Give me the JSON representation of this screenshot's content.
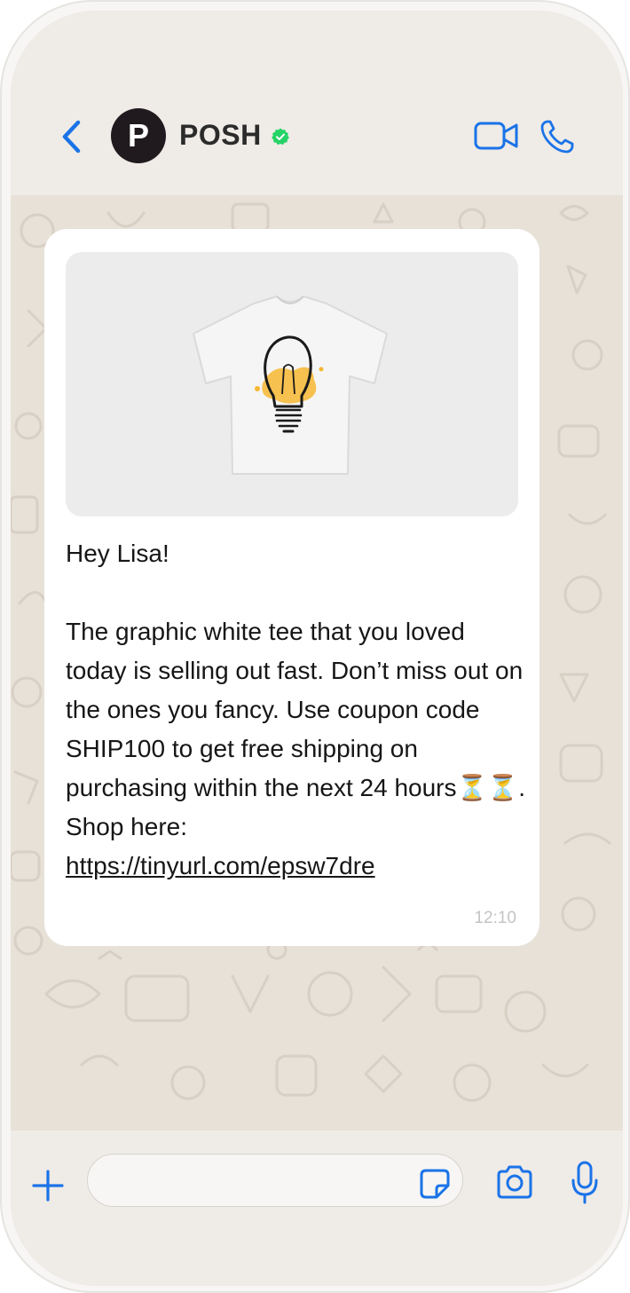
{
  "header": {
    "avatar_letter": "P",
    "contact_name": "POSH"
  },
  "message": {
    "image": "graphic-white-tee-lightbulb",
    "text": "Hey Lisa!\n\nThe graphic white tee that you loved today is selling out fast. Don’t miss out on the ones you fancy. Use coupon code SHIP100 to get free shipping on purchasing within the next 24 hours⏳⏳. Shop here:\n",
    "link": "https://tinyurl.com/epsw7dre",
    "time": "12:10"
  },
  "input": {
    "placeholder": ""
  },
  "icons": [
    "back-icon",
    "verified-icon",
    "video-call-icon",
    "phone-icon",
    "plus-icon",
    "sticker-icon",
    "camera-icon",
    "microphone-icon"
  ],
  "colors": {
    "accent": "#1a73e8",
    "verified": "#25d366",
    "avatar_bg": "#201a1f",
    "header_bg": "#efebe6",
    "wallpaper": "#e7e1d8",
    "bubble": "#ffffff"
  }
}
